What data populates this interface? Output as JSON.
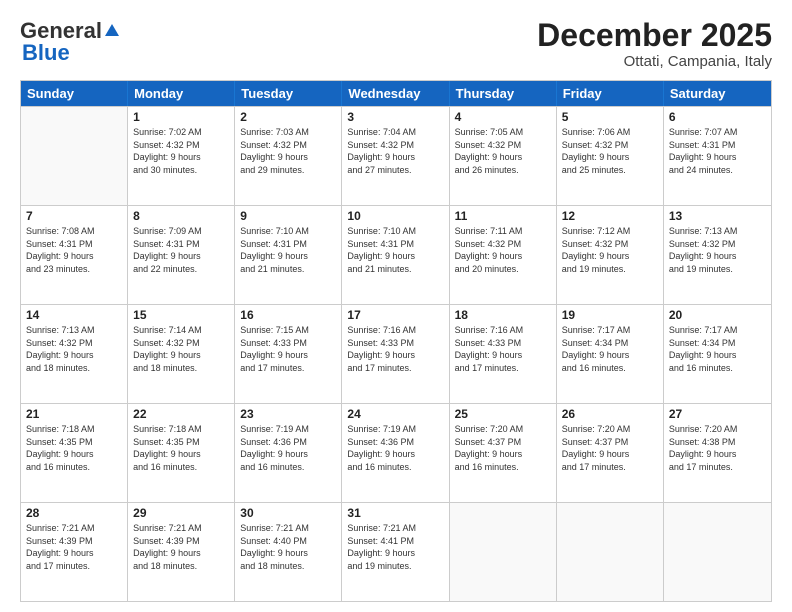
{
  "header": {
    "logo_general": "General",
    "logo_blue": "Blue",
    "month_title": "December 2025",
    "location": "Ottati, Campania, Italy"
  },
  "days_of_week": [
    "Sunday",
    "Monday",
    "Tuesday",
    "Wednesday",
    "Thursday",
    "Friday",
    "Saturday"
  ],
  "weeks": [
    [
      {
        "day": "",
        "lines": []
      },
      {
        "day": "1",
        "lines": [
          "Sunrise: 7:02 AM",
          "Sunset: 4:32 PM",
          "Daylight: 9 hours",
          "and 30 minutes."
        ]
      },
      {
        "day": "2",
        "lines": [
          "Sunrise: 7:03 AM",
          "Sunset: 4:32 PM",
          "Daylight: 9 hours",
          "and 29 minutes."
        ]
      },
      {
        "day": "3",
        "lines": [
          "Sunrise: 7:04 AM",
          "Sunset: 4:32 PM",
          "Daylight: 9 hours",
          "and 27 minutes."
        ]
      },
      {
        "day": "4",
        "lines": [
          "Sunrise: 7:05 AM",
          "Sunset: 4:32 PM",
          "Daylight: 9 hours",
          "and 26 minutes."
        ]
      },
      {
        "day": "5",
        "lines": [
          "Sunrise: 7:06 AM",
          "Sunset: 4:32 PM",
          "Daylight: 9 hours",
          "and 25 minutes."
        ]
      },
      {
        "day": "6",
        "lines": [
          "Sunrise: 7:07 AM",
          "Sunset: 4:31 PM",
          "Daylight: 9 hours",
          "and 24 minutes."
        ]
      }
    ],
    [
      {
        "day": "7",
        "lines": [
          "Sunrise: 7:08 AM",
          "Sunset: 4:31 PM",
          "Daylight: 9 hours",
          "and 23 minutes."
        ]
      },
      {
        "day": "8",
        "lines": [
          "Sunrise: 7:09 AM",
          "Sunset: 4:31 PM",
          "Daylight: 9 hours",
          "and 22 minutes."
        ]
      },
      {
        "day": "9",
        "lines": [
          "Sunrise: 7:10 AM",
          "Sunset: 4:31 PM",
          "Daylight: 9 hours",
          "and 21 minutes."
        ]
      },
      {
        "day": "10",
        "lines": [
          "Sunrise: 7:10 AM",
          "Sunset: 4:31 PM",
          "Daylight: 9 hours",
          "and 21 minutes."
        ]
      },
      {
        "day": "11",
        "lines": [
          "Sunrise: 7:11 AM",
          "Sunset: 4:32 PM",
          "Daylight: 9 hours",
          "and 20 minutes."
        ]
      },
      {
        "day": "12",
        "lines": [
          "Sunrise: 7:12 AM",
          "Sunset: 4:32 PM",
          "Daylight: 9 hours",
          "and 19 minutes."
        ]
      },
      {
        "day": "13",
        "lines": [
          "Sunrise: 7:13 AM",
          "Sunset: 4:32 PM",
          "Daylight: 9 hours",
          "and 19 minutes."
        ]
      }
    ],
    [
      {
        "day": "14",
        "lines": [
          "Sunrise: 7:13 AM",
          "Sunset: 4:32 PM",
          "Daylight: 9 hours",
          "and 18 minutes."
        ]
      },
      {
        "day": "15",
        "lines": [
          "Sunrise: 7:14 AM",
          "Sunset: 4:32 PM",
          "Daylight: 9 hours",
          "and 18 minutes."
        ]
      },
      {
        "day": "16",
        "lines": [
          "Sunrise: 7:15 AM",
          "Sunset: 4:33 PM",
          "Daylight: 9 hours",
          "and 17 minutes."
        ]
      },
      {
        "day": "17",
        "lines": [
          "Sunrise: 7:16 AM",
          "Sunset: 4:33 PM",
          "Daylight: 9 hours",
          "and 17 minutes."
        ]
      },
      {
        "day": "18",
        "lines": [
          "Sunrise: 7:16 AM",
          "Sunset: 4:33 PM",
          "Daylight: 9 hours",
          "and 17 minutes."
        ]
      },
      {
        "day": "19",
        "lines": [
          "Sunrise: 7:17 AM",
          "Sunset: 4:34 PM",
          "Daylight: 9 hours",
          "and 16 minutes."
        ]
      },
      {
        "day": "20",
        "lines": [
          "Sunrise: 7:17 AM",
          "Sunset: 4:34 PM",
          "Daylight: 9 hours",
          "and 16 minutes."
        ]
      }
    ],
    [
      {
        "day": "21",
        "lines": [
          "Sunrise: 7:18 AM",
          "Sunset: 4:35 PM",
          "Daylight: 9 hours",
          "and 16 minutes."
        ]
      },
      {
        "day": "22",
        "lines": [
          "Sunrise: 7:18 AM",
          "Sunset: 4:35 PM",
          "Daylight: 9 hours",
          "and 16 minutes."
        ]
      },
      {
        "day": "23",
        "lines": [
          "Sunrise: 7:19 AM",
          "Sunset: 4:36 PM",
          "Daylight: 9 hours",
          "and 16 minutes."
        ]
      },
      {
        "day": "24",
        "lines": [
          "Sunrise: 7:19 AM",
          "Sunset: 4:36 PM",
          "Daylight: 9 hours",
          "and 16 minutes."
        ]
      },
      {
        "day": "25",
        "lines": [
          "Sunrise: 7:20 AM",
          "Sunset: 4:37 PM",
          "Daylight: 9 hours",
          "and 16 minutes."
        ]
      },
      {
        "day": "26",
        "lines": [
          "Sunrise: 7:20 AM",
          "Sunset: 4:37 PM",
          "Daylight: 9 hours",
          "and 17 minutes."
        ]
      },
      {
        "day": "27",
        "lines": [
          "Sunrise: 7:20 AM",
          "Sunset: 4:38 PM",
          "Daylight: 9 hours",
          "and 17 minutes."
        ]
      }
    ],
    [
      {
        "day": "28",
        "lines": [
          "Sunrise: 7:21 AM",
          "Sunset: 4:39 PM",
          "Daylight: 9 hours",
          "and 17 minutes."
        ]
      },
      {
        "day": "29",
        "lines": [
          "Sunrise: 7:21 AM",
          "Sunset: 4:39 PM",
          "Daylight: 9 hours",
          "and 18 minutes."
        ]
      },
      {
        "day": "30",
        "lines": [
          "Sunrise: 7:21 AM",
          "Sunset: 4:40 PM",
          "Daylight: 9 hours",
          "and 18 minutes."
        ]
      },
      {
        "day": "31",
        "lines": [
          "Sunrise: 7:21 AM",
          "Sunset: 4:41 PM",
          "Daylight: 9 hours",
          "and 19 minutes."
        ]
      },
      {
        "day": "",
        "lines": []
      },
      {
        "day": "",
        "lines": []
      },
      {
        "day": "",
        "lines": []
      }
    ]
  ]
}
